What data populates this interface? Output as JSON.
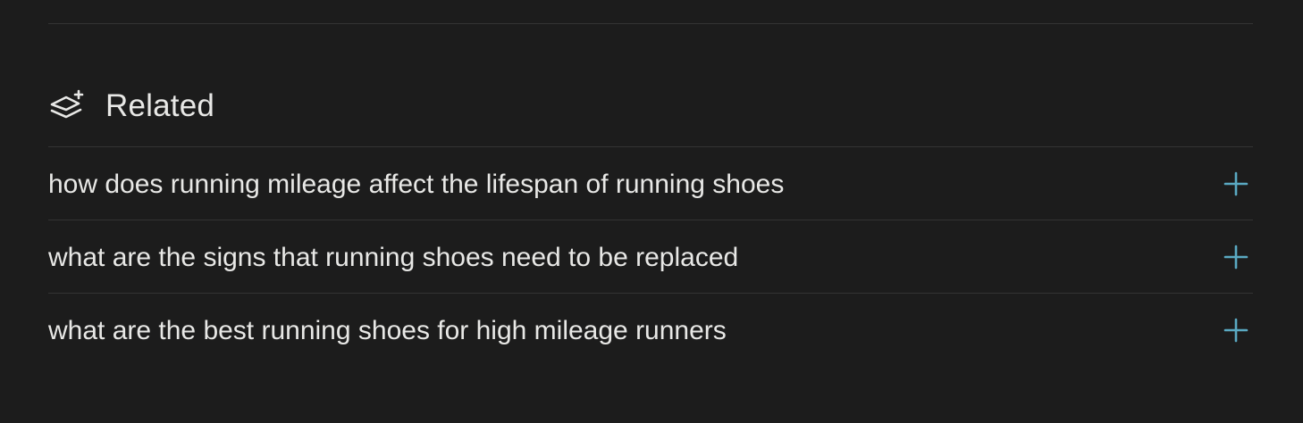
{
  "colors": {
    "background": "#1c1c1c",
    "divider": "#333333",
    "text": "#e8e8e6",
    "accent": "#5aa9c2"
  },
  "related": {
    "icon": "layers-sparkle-icon",
    "title": "Related",
    "items": [
      {
        "label": "how does running mileage affect the lifespan of running shoes",
        "icon": "plus-icon"
      },
      {
        "label": "what are the signs that running shoes need to be replaced",
        "icon": "plus-icon"
      },
      {
        "label": "what are the best running shoes for high mileage runners",
        "icon": "plus-icon"
      }
    ]
  }
}
